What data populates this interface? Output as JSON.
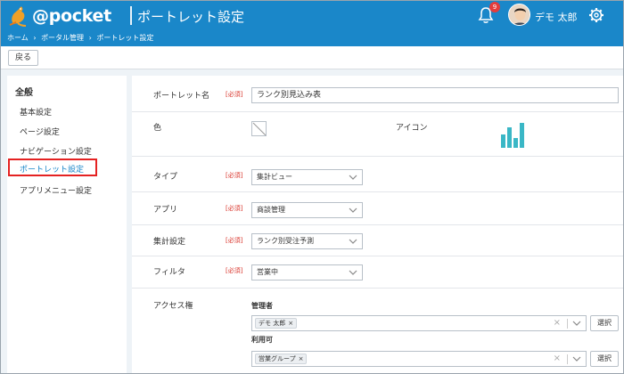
{
  "app": {
    "logo_text": "@pocket",
    "page_title": "ポートレット設定"
  },
  "header": {
    "notification_count": "9",
    "user_name": "デモ 太郎"
  },
  "breadcrumb": [
    "ホーム",
    "›",
    "ポータル管理",
    "›",
    "ポートレット設定"
  ],
  "toolbar": {
    "back_label": "戻る"
  },
  "sidebar": {
    "heading": "全般",
    "items": [
      {
        "label": "基本設定"
      },
      {
        "label": "ページ設定"
      },
      {
        "label": "ナビゲーション設定"
      },
      {
        "label": "ポートレット設定",
        "active": true
      },
      {
        "label": "アプリメニュー設定"
      }
    ]
  },
  "form": {
    "required_label": "[必須]",
    "portlet_name": {
      "label": "ポートレット名",
      "value": "ランク別見込み表"
    },
    "color": {
      "label": "色"
    },
    "icon": {
      "label": "アイコン",
      "icon_name": "bar-chart-icon",
      "color": "#3ab7c6"
    },
    "type": {
      "label": "タイプ",
      "value": "集計ビュー"
    },
    "app": {
      "label": "アプリ",
      "value": "商談管理"
    },
    "aggregation": {
      "label": "集計設定",
      "value": "ランク別受注予測"
    },
    "filter": {
      "label": "フィルタ",
      "value": "営業中"
    },
    "access": {
      "label": "アクセス権",
      "admin_label": "管理者",
      "admin_chip": "デモ 太郎",
      "user_label": "利用可",
      "user_chip": "営業グループ",
      "chip_remove": "×",
      "clear": "×",
      "select_button": "選択"
    }
  },
  "colors": {
    "header": "#1a87c9",
    "required": "#d9342b",
    "active_outline": "#e42222"
  }
}
